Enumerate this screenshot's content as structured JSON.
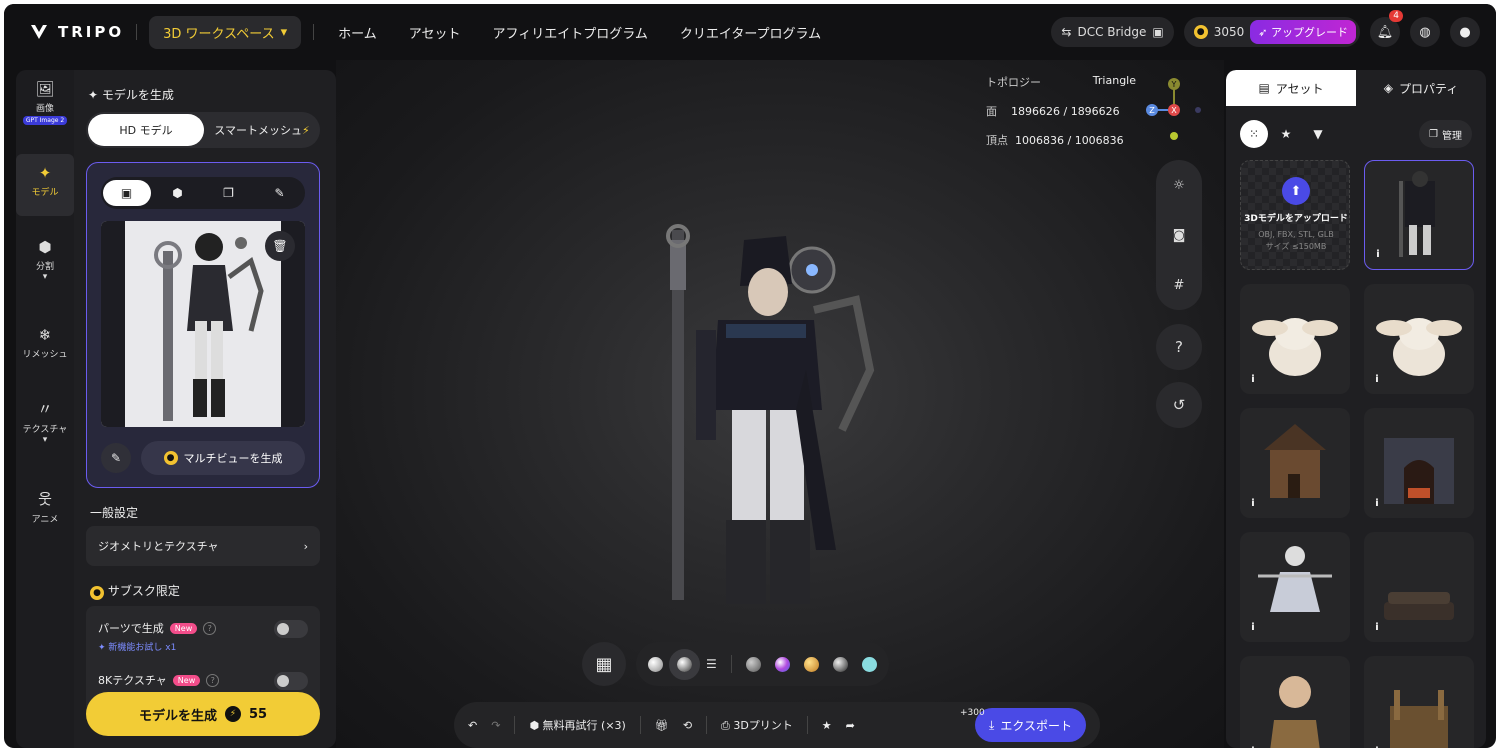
{
  "topbar": {
    "logo": "TRIPO",
    "workspace": "3D ワークスペース",
    "nav": [
      "ホーム",
      "アセット",
      "アフィリエイトプログラム",
      "クリエイタープログラム"
    ],
    "dcc": "DCC Bridge",
    "credits": "3050",
    "upgrade": "アップグレード",
    "notifications": "4"
  },
  "rail": {
    "items": [
      {
        "label": "画像",
        "icon": "image-icon"
      },
      {
        "label": "モデル",
        "icon": "sparkle-icon"
      },
      {
        "label": "分割",
        "icon": "cube-icon"
      },
      {
        "label": "リメッシュ",
        "icon": "mesh-icon"
      },
      {
        "label": "テクスチャ",
        "icon": "texture-icon"
      },
      {
        "label": "アニメ",
        "icon": "figure-icon"
      }
    ],
    "gpt_tag": "GPT Image 2"
  },
  "left": {
    "title": "モデルを生成",
    "seg_hd": "HD モデル",
    "seg_smart": "スマートメッシュ",
    "multiview": "マルチビューを生成",
    "general": "一般設定",
    "geo_tex": "ジオメトリとテクスチャ",
    "subs_only": "サブスク限定",
    "parts": "パーツで生成",
    "new": "New",
    "trial": "新機能お試し x1",
    "tex8k": "8Kテクスチャ",
    "generate": "モデルを生成",
    "cost": "55"
  },
  "viewport": {
    "topology_label": "トポロジー",
    "topology_value": "Triangle",
    "faces_label": "面",
    "faces_value": "1896626 / 1896626",
    "verts_label": "頂点",
    "verts_value": "1006836 / 1006836",
    "axis_y": "Y",
    "axis_z": "Z",
    "axis_x": "X"
  },
  "bottombar": {
    "retry": "無料再試行 (×3)",
    "print": "3Dプリント",
    "bonus": "+300",
    "export": "エクスポート"
  },
  "right": {
    "tab_assets": "アセット",
    "tab_props": "プロパティ",
    "manage": "管理",
    "upload_title": "3Dモデルをアップロード",
    "upload_formats": "OBJ, FBX, STL, GLB",
    "upload_size": "サイズ ≤150MB"
  },
  "colors": {
    "accent": "#f2cc36",
    "primary": "#4a4ae6",
    "select": "#6b5cf0"
  }
}
